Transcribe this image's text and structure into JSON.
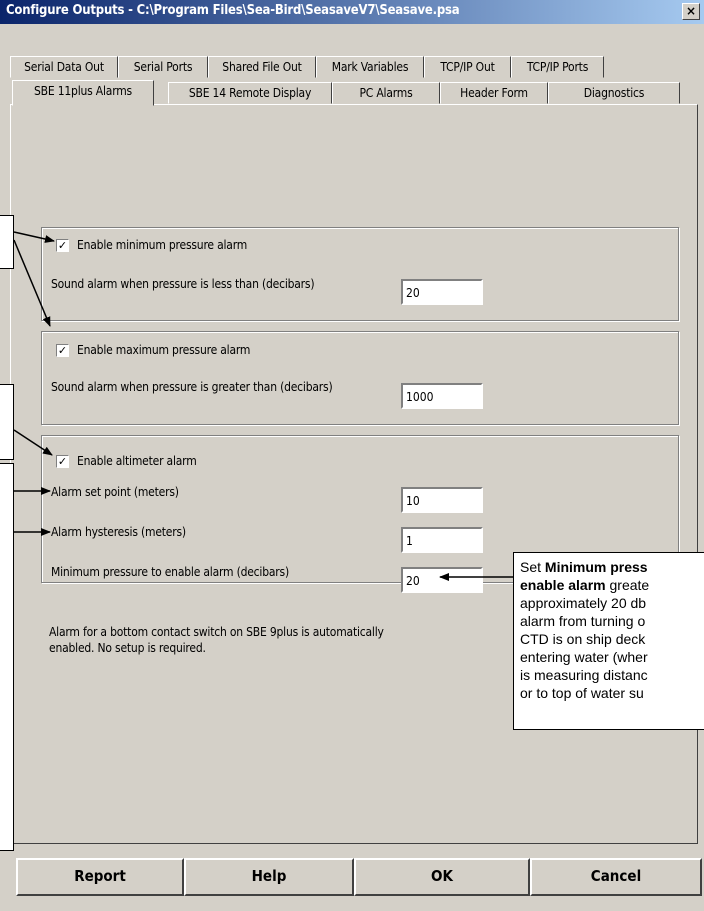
{
  "window": {
    "title": "Configure Outputs - C:\\Program Files\\Sea-Bird\\SeasaveV7\\Seasave.psa",
    "close_glyph": "×"
  },
  "tabs_row1": [
    {
      "label": "Serial Data Out"
    },
    {
      "label": "Serial Ports"
    },
    {
      "label": "Shared File Out"
    },
    {
      "label": "Mark Variables"
    },
    {
      "label": "TCP/IP Out"
    },
    {
      "label": "TCP/IP Ports"
    }
  ],
  "tabs_row2": [
    {
      "label": "SBE 11plus Alarms"
    },
    {
      "label": "SBE 14 Remote Display"
    },
    {
      "label": "PC Alarms"
    },
    {
      "label": "Header Form"
    },
    {
      "label": "Diagnostics"
    }
  ],
  "min_pressure": {
    "enable_label": "Enable minimum pressure alarm",
    "enabled": true,
    "sound_label": "Sound alarm when pressure is less than (decibars)",
    "value": "20"
  },
  "max_pressure": {
    "enable_label": "Enable maximum pressure alarm",
    "enabled": true,
    "sound_label": "Sound alarm when pressure is greater than (decibars)",
    "value": "1000"
  },
  "altimeter": {
    "enable_label": "Enable altimeter alarm",
    "enabled": true,
    "setpoint_label": "Alarm set point (meters)",
    "setpoint_value": "10",
    "hysteresis_label": "Alarm hysteresis (meters)",
    "hysteresis_value": "1",
    "minpress_label": "Minimum pressure to enable alarm (decibars)",
    "minpress_value": "20"
  },
  "note": {
    "line1": "Alarm for a bottom contact switch on SBE 9plus is automatically",
    "line2": "enabled.  No setup is required."
  },
  "buttons": {
    "report": "Report",
    "help": "Help",
    "ok": "OK",
    "cancel": "Cancel"
  },
  "check_glyph": "✓",
  "callout": {
    "set": "Set ",
    "bold1": "Minimum press",
    "bold2": "enable alarm",
    "after2": " greate",
    "line3": "approximately 20 db",
    "line4": "alarm from turning o",
    "line5": "CTD is on ship deck",
    "line6": "entering water (wher",
    "line7": "is measuring distanc",
    "line8": "or to top of water su"
  }
}
